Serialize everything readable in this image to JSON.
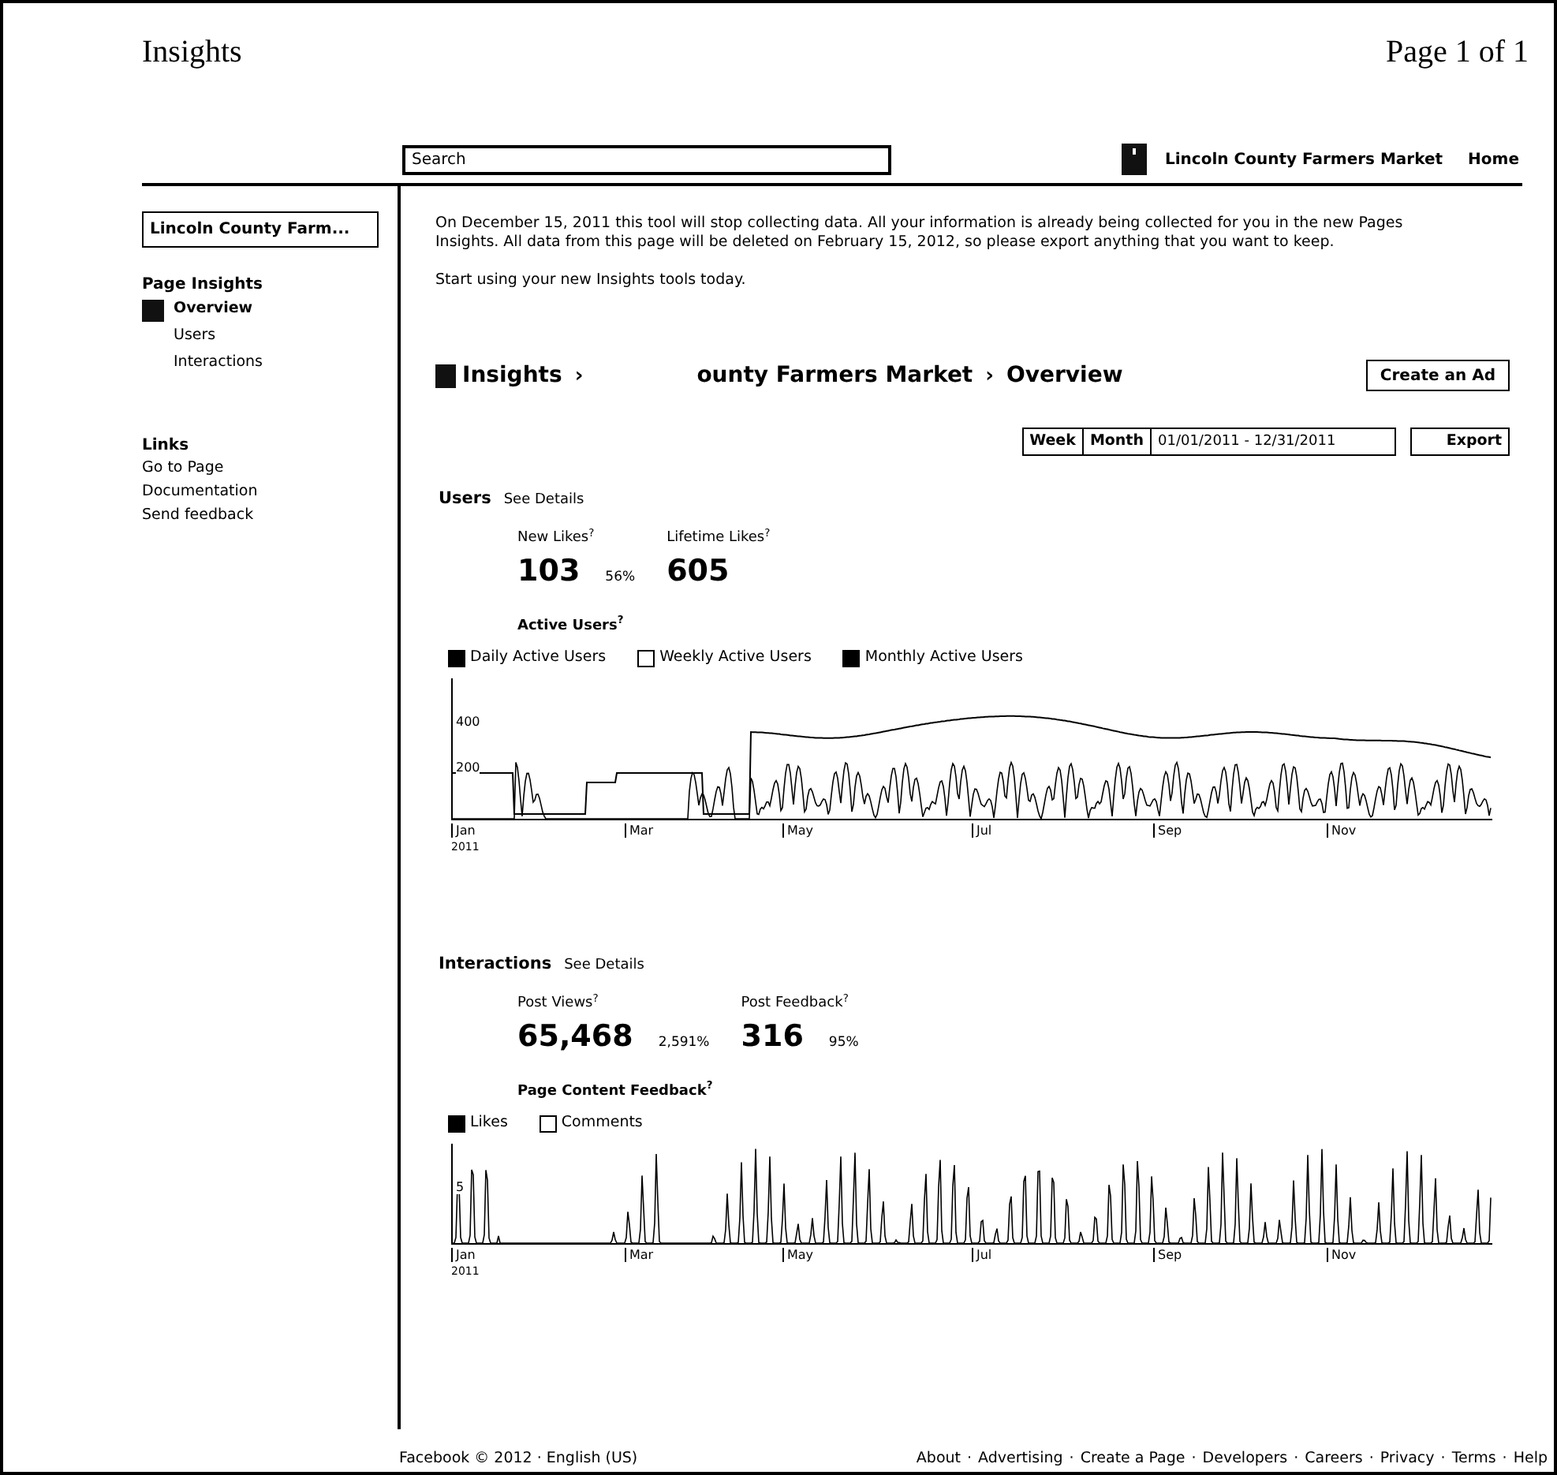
{
  "print_header": {
    "title": "Insights",
    "page": "Page 1 of 1"
  },
  "top_bar": {
    "search": {
      "placeholder": "Search"
    },
    "page_name": "Lincoln County Farmers Market",
    "home": "Home"
  },
  "sidebar": {
    "page_select": "Lincoln County Farm...",
    "section_title": "Page Insights",
    "items": [
      {
        "label": "Overview",
        "selected": true,
        "children": [
          {
            "label": "Users",
            "selected": false
          },
          {
            "label": "Interactions",
            "selected": false
          }
        ]
      }
    ],
    "links_title": "Links",
    "links": [
      "Go to Page",
      "Documentation",
      "Send feedback"
    ]
  },
  "notice": [
    "On December 15, 2011 this tool will stop collecting data. All your information is already being collected for you in the new Pages Insights. All data from this page will be deleted on February 15, 2012, so please export anything that you want to keep.",
    "Start using your new Insights tools today."
  ],
  "breadcrumb": {
    "root": "Insights",
    "separator": "›",
    "page": "ounty Farmers Market",
    "current": "Overview"
  },
  "create_ad": "Create an Ad",
  "range": {
    "tabs": [
      {
        "label": "Week",
        "selected": false
      },
      {
        "label": "Month",
        "selected": false
      }
    ],
    "value": "01/01/2011 - 12/31/2011",
    "export": "Export"
  },
  "sections": [
    {
      "title": "Users",
      "details": "See Details",
      "stats": [
        {
          "label": "New Likes$^{?}$",
          "value": "103",
          "change": "56%"
        },
        {
          "label": "Lifetime Likes$^{?}$",
          "value": "605"
        }
      ],
      "chart_title": "Active Users$^{?}$",
      "toggles": [
        {
          "label": "Daily Active Users",
          "checked": true
        },
        {
          "label": "Weekly Active Users",
          "checked": false
        },
        {
          "label": "Monthly Active Users",
          "checked": true
        }
      ],
      "y_labels": [
        "400",
        "200"
      ],
      "x_labels": [
        "Jan",
        "Mar",
        "May",
        "Jul",
        "Sep",
        "Nov"
      ],
      "x_sublabel": "2011"
    },
    {
      "title": "Interactions",
      "details": "See Details",
      "stats": [
        {
          "label": "Post Views$^{?}$",
          "value": "65,468",
          "change": "2,591%"
        },
        {
          "label": "Post Feedback$^{?}$",
          "value": "316",
          "change": "95%"
        }
      ],
      "chart_title": "Page Content Feedback$^{?}$",
      "toggles": [
        {
          "label": "Likes",
          "checked": true
        },
        {
          "label": "Comments",
          "checked": false
        }
      ],
      "y_labels": [
        "5"
      ],
      "x_labels": [
        "Jan",
        "Mar",
        "May",
        "Jul",
        "Sep",
        "Nov"
      ],
      "x_sublabel": "2011"
    }
  ],
  "footer": {
    "left": "Facebook © 2012 · English (US)",
    "separator": "·",
    "links": [
      "About",
      "Advertising",
      "Create a Page",
      "Developers",
      "Careers",
      "Privacy",
      "Terms",
      "Help"
    ]
  }
}
